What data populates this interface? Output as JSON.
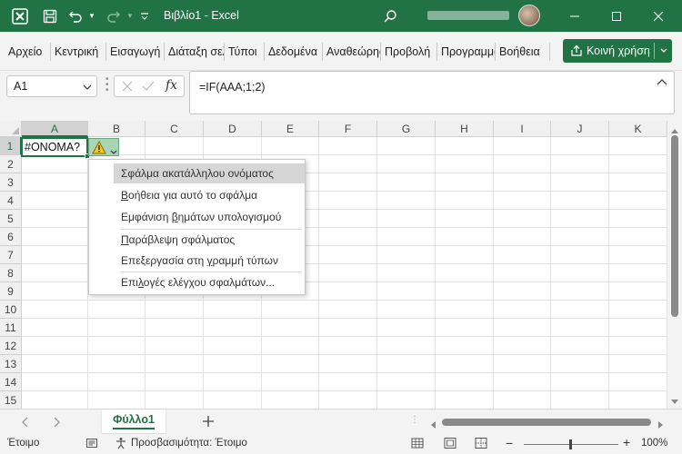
{
  "window": {
    "title": "Βιβλίο1  -  Excel"
  },
  "icons": {
    "app": "excel-logo-icon",
    "save": "save-icon",
    "undo": "undo-icon",
    "redo": "redo-icon",
    "qat": "customize-quick-access-icon",
    "search": "search-icon",
    "minimize": "minimize-icon",
    "maximize": "maximize-icon",
    "close": "close-icon"
  },
  "ribbon": {
    "tabs": [
      {
        "label": "Αρχείο"
      },
      {
        "label": "Κεντρική"
      },
      {
        "label": "Εισαγωγή"
      },
      {
        "label": "Διάταξη σελίδας"
      },
      {
        "label": "Τύποι"
      },
      {
        "label": "Δεδομένα"
      },
      {
        "label": "Αναθεώρηση"
      },
      {
        "label": "Προβολή"
      },
      {
        "label": "Προγραμματιστής"
      },
      {
        "label": "Βοήθεια"
      }
    ],
    "share_label": "Κοινή χρήση"
  },
  "formula_bar": {
    "name_box": "A1",
    "fx": "fx",
    "formula": "=IF(AAA;1;2)"
  },
  "grid": {
    "columns": [
      "A",
      "B",
      "C",
      "D",
      "E",
      "F",
      "G",
      "H",
      "I",
      "J",
      "K"
    ],
    "rows": [
      "1",
      "2",
      "3",
      "4",
      "5",
      "6",
      "7",
      "8",
      "9",
      "10",
      "11",
      "12",
      "13",
      "14",
      "15"
    ],
    "active_cell_value": "#ΟΝΟΜΑ?"
  },
  "error_menu": {
    "header": "Σφάλμα ακατάλληλου ονόματος",
    "items": [
      {
        "pre": "",
        "key": "Β",
        "post": "οήθεια για αυτό το σφάλμα"
      },
      {
        "pre": "Εμφάνιση ",
        "key": "β",
        "post": "ημάτων υπολογισμού"
      },
      {
        "pre": "",
        "key": "Π",
        "post": "αράβλεψη σφάλματος"
      },
      {
        "pre": "Επεξεργασία στη ",
        "key": "γ",
        "post": "ραμμή τύπων"
      },
      {
        "pre": "Επι",
        "key": "λ",
        "post": "ογές ελέγχου σφαλμάτων..."
      }
    ]
  },
  "sheets": {
    "active": "Φύλλο1"
  },
  "status_bar": {
    "ready": "Έτοιμο",
    "accessibility": "Προσβασιμότητα: Έτοιμο",
    "zoom": "100%",
    "zoom_level": 1.0
  }
}
